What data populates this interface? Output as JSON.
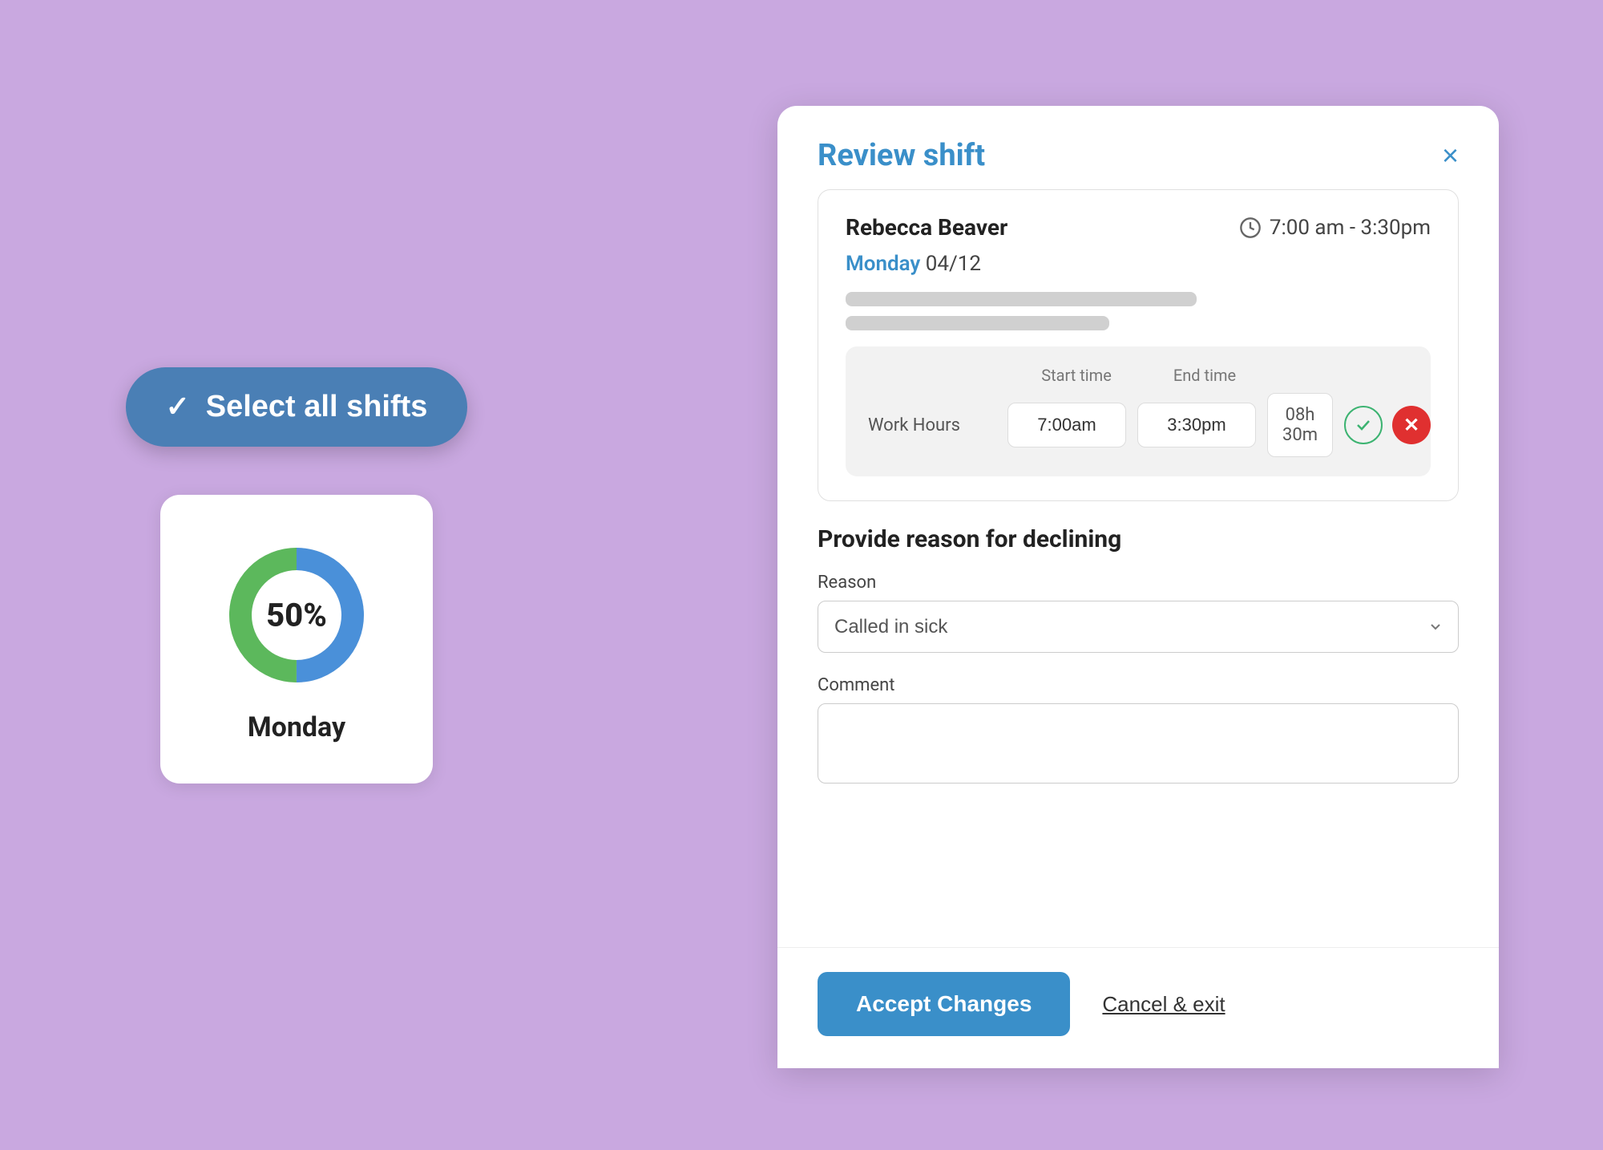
{
  "background_color": "#c9a8e0",
  "left": {
    "select_button": {
      "label": "Select all shifts",
      "checkmark": "✓"
    },
    "donut_card": {
      "percentage": "50%",
      "day": "Monday",
      "blue_percent": 50,
      "green_percent": 50
    }
  },
  "modal": {
    "title": "Review shift",
    "close_label": "×",
    "employee": {
      "name": "Rebecca Beaver",
      "time_range": "7:00 am - 3:30pm",
      "date_day": "Monday",
      "date_rest": " 04/12"
    },
    "work_hours": {
      "section_title": "Work Hours",
      "start_label": "Start time",
      "end_label": "End time",
      "start_value": "7:00am",
      "end_value": "3:30pm",
      "duration": "08h 30m"
    },
    "decline": {
      "title": "Provide reason for declining",
      "reason_label": "Reason",
      "reason_value": "Called in sick",
      "comment_label": "Comment",
      "comment_placeholder": ""
    },
    "footer": {
      "accept_label": "Accept Changes",
      "cancel_label": "Cancel & exit"
    }
  }
}
